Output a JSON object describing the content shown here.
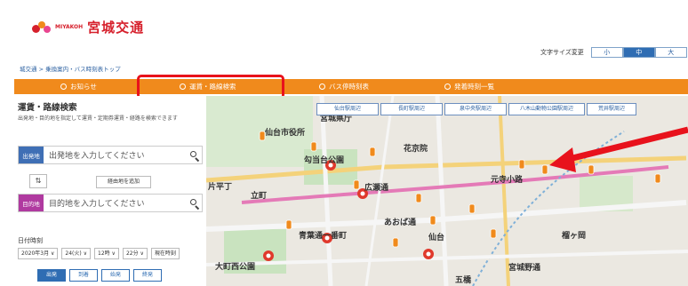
{
  "header": {
    "logo_small": "MIYAKOH",
    "logo_main": "宮城交通"
  },
  "font_size": {
    "label": "文字サイズ変更",
    "options": [
      "小",
      "中",
      "大"
    ],
    "active": "中"
  },
  "breadcrumb": "城交通 > 乗換案内・バス時刻表トップ",
  "nav": {
    "items": [
      "お知らせ",
      "運賃・路線検索",
      "バス停時刻表",
      "発着時刻一覧"
    ],
    "active": "運賃・路線検索"
  },
  "search": {
    "title": "運賃・路線検索",
    "description": "出発地・目的地を指定して運賃・定期券運賃・経路を検索できます",
    "origin_tag": "出発地",
    "origin_placeholder": "出発地を入力してください",
    "dest_tag": "目的地",
    "dest_placeholder": "目的地を入力してください",
    "swap_label": "⇅",
    "via_label": "経由地を追加",
    "datetime_label": "日付時刻",
    "date_parts": [
      "2020年3月 ∨",
      "24(火) ∨",
      "12時 ∨",
      "22分 ∨",
      "現在時刻"
    ],
    "modes": [
      "出発",
      "到着",
      "始発",
      "終発"
    ]
  },
  "map": {
    "station_tabs": [
      "仙台駅周辺",
      "長町駅周辺",
      "泉中央駅周辺",
      "八木山動物公園駅周辺",
      "荒井駅周辺"
    ],
    "place_labels": [
      "宮城県庁",
      "仙台市役所",
      "勾当台公園",
      "青葉通一番町",
      "あおば通",
      "仙台",
      "大町西公園",
      "宮城野通",
      "榴ヶ岡",
      "元寺小路",
      "広瀬通",
      "立町",
      "片平丁",
      "花京院",
      "五橋"
    ]
  },
  "colors": {
    "brand_red": "#d6202c",
    "nav_orange": "#f08a1c",
    "highlight_red": "#e8121c",
    "blue": "#2f6db3",
    "origin_tag": "#3f6fb5",
    "dest_tag": "#b03aa0"
  }
}
